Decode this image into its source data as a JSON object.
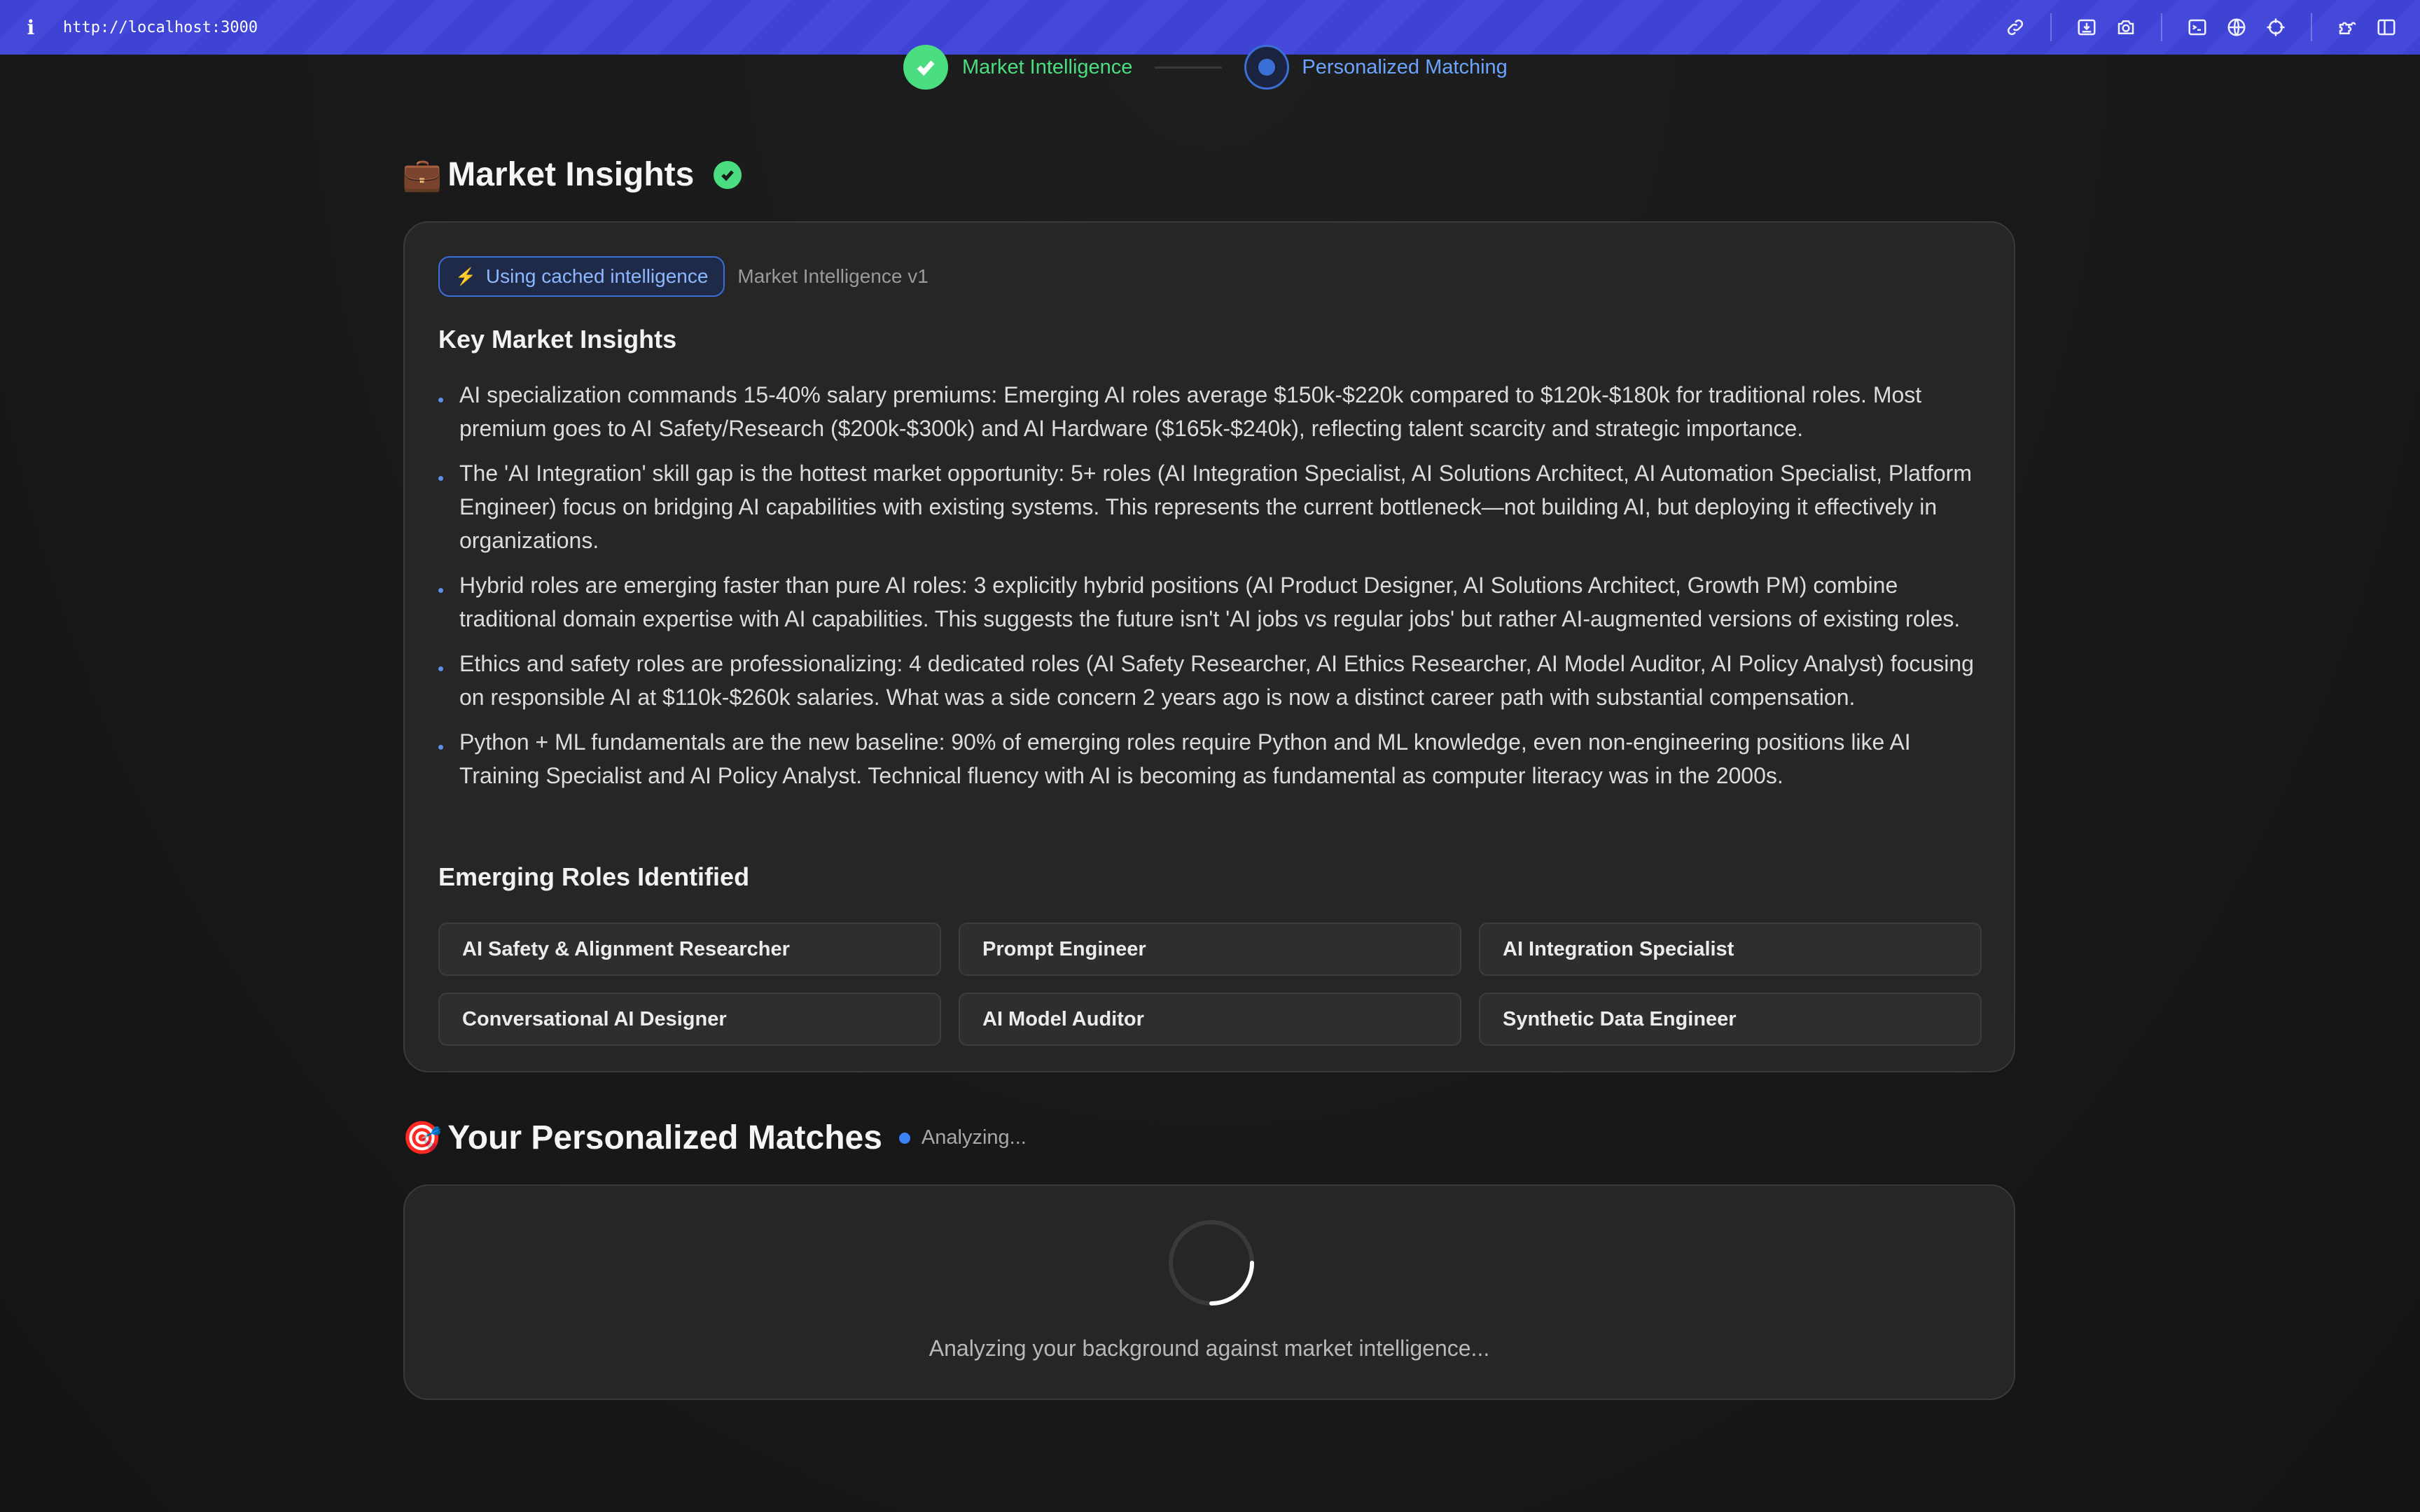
{
  "browser": {
    "url": "http://localhost:3000",
    "icons": [
      "link-icon",
      "download-icon",
      "camera-icon",
      "terminal-icon",
      "globe-icon",
      "crosshair-icon",
      "extension-icon",
      "sidebar-icon"
    ]
  },
  "stepper": {
    "step1_label": "Market Intelligence",
    "step2_label": "Personalized Matching"
  },
  "market": {
    "emoji": "💼",
    "title": "Market Insights",
    "cache_label": "Using cached intelligence",
    "version": "Market Intelligence v1",
    "insights_title": "Key Market Insights",
    "insights": [
      "AI specialization commands 15-40% salary premiums: Emerging AI roles average $150k-$220k compared to $120k-$180k for traditional roles. Most premium goes to AI Safety/Research ($200k-$300k) and AI Hardware ($165k-$240k), reflecting talent scarcity and strategic importance.",
      "The 'AI Integration' skill gap is the hottest market opportunity: 5+ roles (AI Integration Specialist, AI Solutions Architect, AI Automation Specialist, Platform Engineer) focus on bridging AI capabilities with existing systems. This represents the current bottleneck—not building AI, but deploying it effectively in organizations.",
      "Hybrid roles are emerging faster than pure AI roles: 3 explicitly hybrid positions (AI Product Designer, AI Solutions Architect, Growth PM) combine traditional domain expertise with AI capabilities. This suggests the future isn't 'AI jobs vs regular jobs' but rather AI-augmented versions of existing roles.",
      "Ethics and safety roles are professionalizing: 4 dedicated roles (AI Safety Researcher, AI Ethics Researcher, AI Model Auditor, AI Policy Analyst) focusing on responsible AI at $110k-$260k salaries. What was a side concern 2 years ago is now a distinct career path with substantial compensation.",
      "Python + ML fundamentals are the new baseline: 90% of emerging roles require Python and ML knowledge, even non-engineering positions like AI Training Specialist and AI Policy Analyst. Technical fluency with AI is becoming as fundamental as computer literacy was in the 2000s."
    ],
    "roles_title": "Emerging Roles Identified",
    "roles": [
      "AI Safety & Alignment Researcher",
      "Prompt Engineer",
      "AI Integration Specialist",
      "Conversational AI Designer",
      "AI Model Auditor",
      "Synthetic Data Engineer"
    ]
  },
  "matches": {
    "emoji": "🎯",
    "title": "Your Personalized Matches",
    "status": "Analyzing...",
    "loading_text": "Analyzing your background against market intelligence..."
  },
  "colors": {
    "accent_blue": "#3b6fd6",
    "success_green": "#4ade80",
    "topbar": "#4045d6"
  }
}
